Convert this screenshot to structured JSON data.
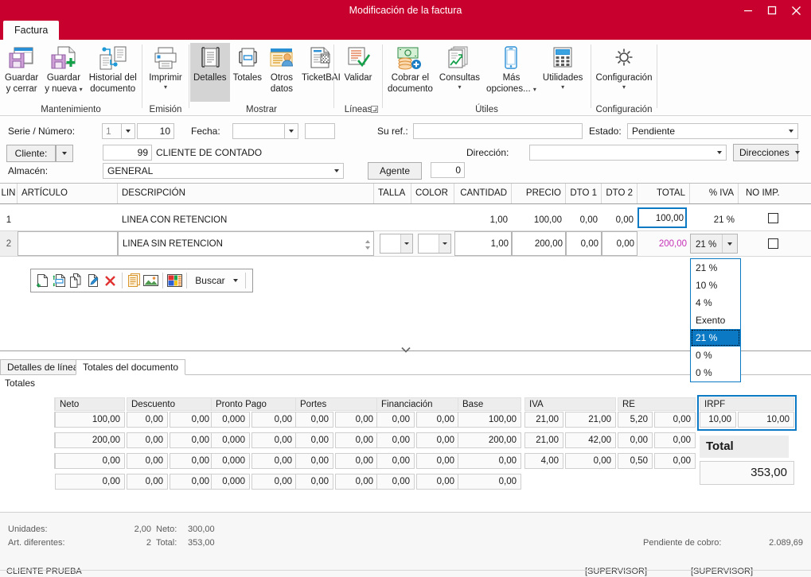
{
  "window": {
    "title": "Modificación de la factura",
    "minimize_icon": "minimize-icon",
    "maximize_icon": "maximize-icon",
    "close_icon": "close-icon",
    "accent_color": "#c8002d"
  },
  "ribbon": {
    "tab_label": "Factura",
    "groups": [
      {
        "name": "Mantenimiento",
        "buttons": [
          {
            "label_line1": "Guardar",
            "label_line2": "y cerrar",
            "icon": "save-close-icon",
            "has_caret": false
          },
          {
            "label_line1": "Guardar",
            "label_line2": "y nueva",
            "icon": "save-new-icon",
            "has_caret": true
          },
          {
            "label_line1": "Historial del",
            "label_line2": "documento",
            "icon": "document-history-icon",
            "has_caret": false
          }
        ]
      },
      {
        "name": "Emisión",
        "buttons": [
          {
            "label_line1": "Imprimir",
            "label_line2": "",
            "icon": "printer-icon",
            "has_caret": true
          }
        ]
      },
      {
        "name": "Mostrar",
        "buttons": [
          {
            "label_line1": "Detalles",
            "label_line2": "",
            "icon": "details-icon",
            "has_caret": false,
            "selected": true
          },
          {
            "label_line1": "Totales",
            "label_line2": "",
            "icon": "totals-icon",
            "has_caret": false
          },
          {
            "label_line1": "Otros",
            "label_line2": "datos",
            "icon": "other-data-icon",
            "has_caret": false
          },
          {
            "label_line1": "TicketBAI",
            "label_line2": "",
            "icon": "ticketbai-icon",
            "has_caret": false
          }
        ]
      },
      {
        "name": "Líneas",
        "buttons": [
          {
            "label_line1": "Validar",
            "label_line2": "",
            "icon": "validate-icon",
            "has_caret": false
          }
        ],
        "has_dialog_launcher": true
      },
      {
        "name": "Útiles",
        "buttons": [
          {
            "label_line1": "Cobrar el",
            "label_line2": "documento",
            "icon": "collect-money-icon",
            "has_caret": false
          },
          {
            "label_line1": "Consultas",
            "label_line2": "",
            "icon": "queries-icon",
            "has_caret": true
          },
          {
            "label_line1": "Más",
            "label_line2": "opciones...",
            "icon": "mobile-icon",
            "has_caret": true
          },
          {
            "label_line1": "Utilidades",
            "label_line2": "",
            "icon": "calculator-icon",
            "has_caret": true
          }
        ]
      },
      {
        "name": "Configuración",
        "buttons": [
          {
            "label_line1": "Configuración",
            "label_line2": "",
            "icon": "gear-icon",
            "has_caret": true
          }
        ]
      }
    ]
  },
  "form": {
    "serie_numero_label": "Serie / Número:",
    "serie_value": "1",
    "numero_value": "10",
    "fecha_label": "Fecha:",
    "fecha_value": "",
    "fecha_extra_value": "",
    "su_ref_label": "Su ref.:",
    "su_ref_value": "",
    "estado_label": "Estado:",
    "estado_value": "Pendiente",
    "cliente_label": "Cliente:",
    "cliente_code": "99",
    "cliente_name": "CLIENTE DE CONTADO",
    "direccion_label": "Dirección:",
    "direccion_value": "",
    "direcciones_button": "Direcciones",
    "almacen_label": "Almacén:",
    "almacen_value": "GENERAL",
    "agente_button": "Agente",
    "agente_value": "0"
  },
  "grid": {
    "columns": [
      {
        "key": "lin",
        "label": "LIN",
        "align": "center"
      },
      {
        "key": "articulo",
        "label": "ARTÍCULO",
        "align": "left"
      },
      {
        "key": "descripcion",
        "label": "DESCRIPCIÓN",
        "align": "left"
      },
      {
        "key": "talla",
        "label": "TALLA",
        "align": "left"
      },
      {
        "key": "color",
        "label": "COLOR",
        "align": "left"
      },
      {
        "key": "cantidad",
        "label": "CANTIDAD",
        "align": "right"
      },
      {
        "key": "precio",
        "label": "PRECIO",
        "align": "right"
      },
      {
        "key": "dto1",
        "label": "DTO 1",
        "align": "right"
      },
      {
        "key": "dto2",
        "label": "DTO 2",
        "align": "right"
      },
      {
        "key": "total",
        "label": "TOTAL",
        "align": "right"
      },
      {
        "key": "iva",
        "label": "% IVA",
        "align": "right"
      },
      {
        "key": "noimp",
        "label": "NO IMP.",
        "align": "center"
      }
    ],
    "rows": [
      {
        "lin": "1",
        "articulo": "",
        "descripcion": "LINEA CON RETENCION",
        "talla": "",
        "color": "",
        "cantidad": "1,00",
        "precio": "100,00",
        "dto1": "0,00",
        "dto2": "0,00",
        "total": "100,00",
        "iva": "21 %",
        "noimp": false
      },
      {
        "lin": "2",
        "articulo": "",
        "descripcion": "LINEA SIN RETENCION",
        "talla": "",
        "color": "",
        "cantidad": "1,00",
        "precio": "200,00",
        "dto1": "0,00",
        "dto2": "0,00",
        "total": "200,00",
        "iva": "21 %",
        "noimp": false
      }
    ]
  },
  "iva_dropdown": {
    "options": [
      "21 %",
      "10 %",
      "4 %",
      "Exento",
      "21 %",
      "0 %",
      "0 %"
    ],
    "selected_index": 4,
    "highlight_color": "#0b79c4"
  },
  "line_toolbar": {
    "icons": [
      "new-line-icon",
      "insert-line-icon",
      "copy-line-icon",
      "edit-line-icon",
      "delete-line-icon",
      "notes-icon",
      "image-icon",
      "colors-icon"
    ],
    "search_label": "Buscar"
  },
  "bottom_tabs": {
    "tabs": [
      {
        "label": "Detalles de línea",
        "active": false
      },
      {
        "label": "Totales del documento",
        "active": true
      }
    ]
  },
  "totals": {
    "section_label": "Totales",
    "headers": [
      "IVA",
      "Neto",
      "Descuento",
      "Pronto Pago",
      "Portes",
      "Financiación",
      "Base",
      "IVA",
      "RE",
      "IRPF"
    ],
    "rows": [
      {
        "iva_pct": "21,00",
        "neto": "100,00",
        "desc_pct": "0,00",
        "desc_imp": "0,00",
        "pp_pct": "0,000",
        "pp_imp": "0,00",
        "portes_pct": "0,00",
        "portes_imp": "0,00",
        "fin_pct": "0,00",
        "fin_imp": "0,00",
        "base": "100,00",
        "iva2_pct": "21,00",
        "iva2_imp": "21,00",
        "re_pct": "5,20",
        "re_imp": "0,00",
        "irpf_pct": "10,00",
        "irpf_imp": "10,00"
      },
      {
        "iva_pct": "21,00",
        "neto": "200,00",
        "desc_pct": "0,00",
        "desc_imp": "0,00",
        "pp_pct": "0,000",
        "pp_imp": "0,00",
        "portes_pct": "0,00",
        "portes_imp": "0,00",
        "fin_pct": "0,00",
        "fin_imp": "0,00",
        "base": "200,00",
        "iva2_pct": "21,00",
        "iva2_imp": "42,00",
        "re_pct": "0,00",
        "re_imp": "0,00",
        "irpf_pct": "",
        "irpf_imp": ""
      },
      {
        "iva_pct": "4,00",
        "neto": "0,00",
        "desc_pct": "0,00",
        "desc_imp": "0,00",
        "pp_pct": "0,000",
        "pp_imp": "0,00",
        "portes_pct": "0,00",
        "portes_imp": "0,00",
        "fin_pct": "0,00",
        "fin_imp": "0,00",
        "base": "0,00",
        "iva2_pct": "4,00",
        "iva2_imp": "0,00",
        "re_pct": "0,50",
        "re_imp": "0,00",
        "irpf_pct": "",
        "irpf_imp": ""
      },
      {
        "iva_pct": "",
        "neto": "0,00",
        "desc_pct": "0,00",
        "desc_imp": "0,00",
        "pp_pct": "0,000",
        "pp_imp": "0,00",
        "portes_pct": "0,00",
        "portes_imp": "0,00",
        "fin_pct": "0,00",
        "fin_imp": "0,00",
        "base": "0,00",
        "iva2_pct": "",
        "iva2_imp": "",
        "re_pct": "",
        "re_imp": "",
        "irpf_pct": "",
        "irpf_imp": ""
      }
    ],
    "total_label": "Total",
    "total_value": "353,00"
  },
  "status": {
    "unidades_label": "Unidades:",
    "unidades_value": "2,00",
    "neto_label": "Neto:",
    "neto_value": "300,00",
    "art_label": "Art. diferentes:",
    "art_value": "2",
    "total_label": "Total:",
    "total_value": "353,00",
    "pendiente_label": "Pendiente de cobro:",
    "pendiente_value": "2.089,69",
    "cliente": "CLIENTE PRUEBA",
    "supervisor_1": "[SUPERVISOR]",
    "supervisor_2": "[SUPERVISOR]"
  }
}
